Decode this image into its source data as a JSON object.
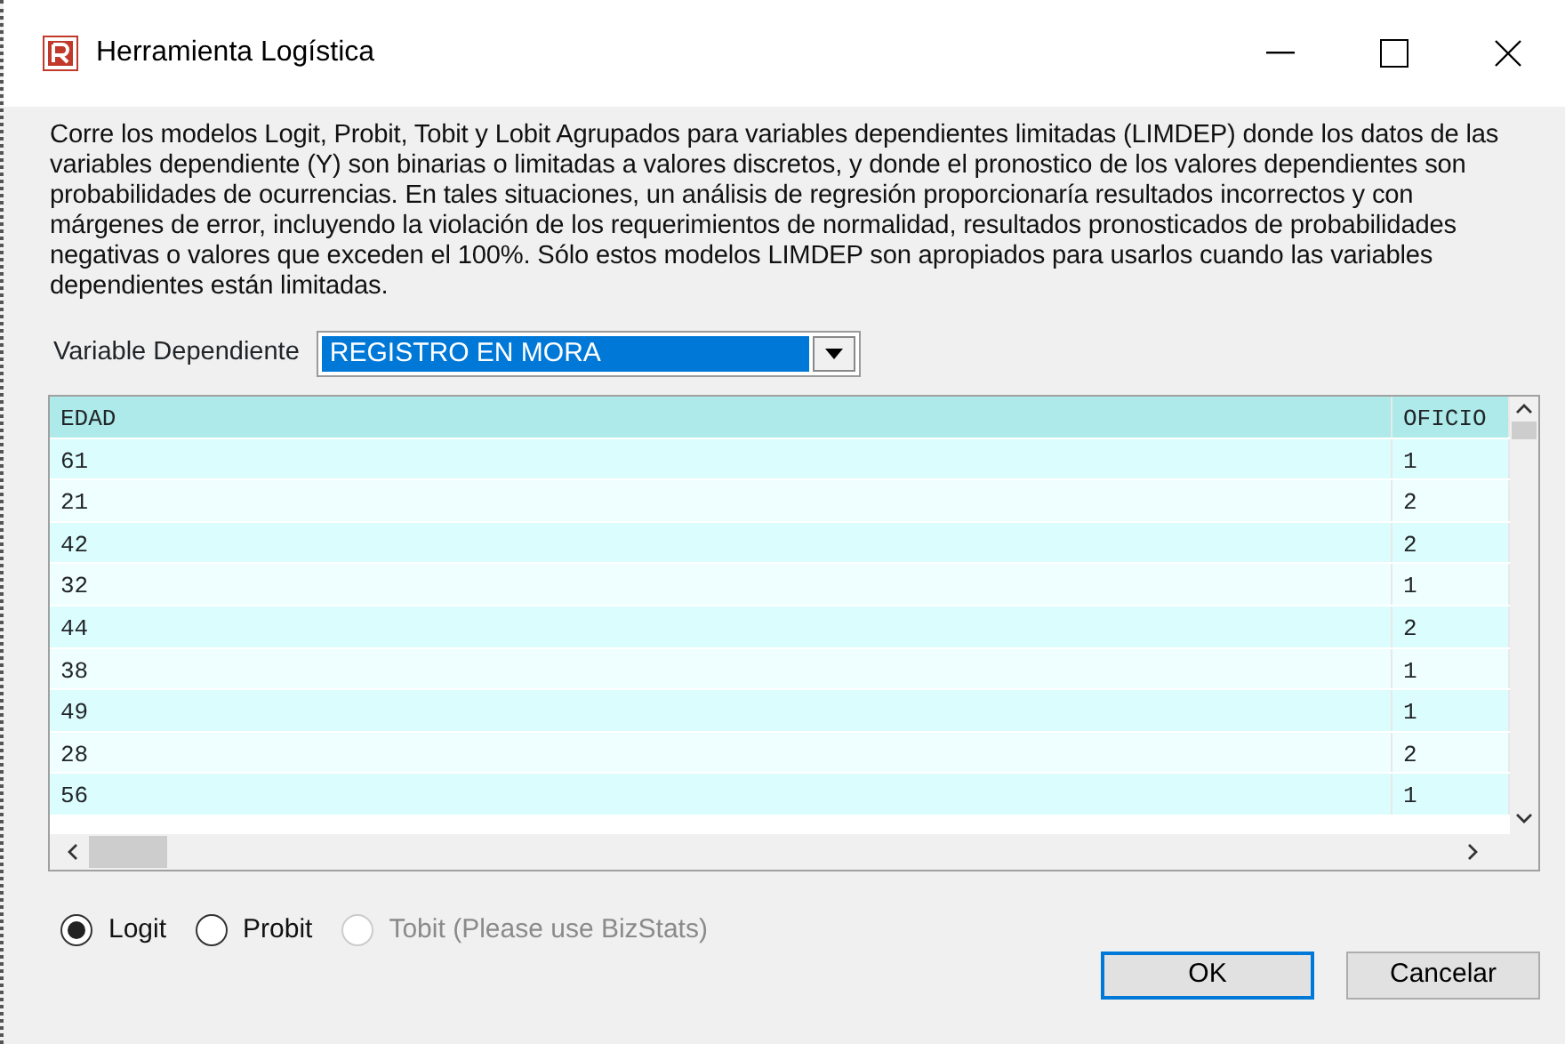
{
  "window": {
    "title": "Herramienta Logística"
  },
  "description": "Corre los modelos Logit, Probit, Tobit y Lobit Agrupados para variables dependientes limitadas (LIMDEP) donde los datos de las variables dependiente (Y) son binarias o limitadas a valores discretos,  y donde el pronostico de los valores dependientes son probabilidades de ocurrencias. En tales situaciones, un análisis de regresión proporcionaría resultados incorrectos y con márgenes de error, incluyendo la violación de los requerimientos de normalidad,  resultados pronosticados de probabilidades negativas o valores que exceden  el 100%. Sólo estos modelos LIMDEP son apropiados para usarlos cuando las variables dependientes están limitadas.",
  "dependent_variable": {
    "label": "Variable Dependiente",
    "value": "REGISTRO EN MORA"
  },
  "table": {
    "columns": [
      "EDAD",
      "OFICIO"
    ],
    "rows": [
      [
        "61",
        "1"
      ],
      [
        "21",
        "2"
      ],
      [
        "42",
        "2"
      ],
      [
        "32",
        "1"
      ],
      [
        "44",
        "2"
      ],
      [
        "38",
        "1"
      ],
      [
        "49",
        "1"
      ],
      [
        "28",
        "2"
      ],
      [
        "56",
        "1"
      ]
    ]
  },
  "models": [
    {
      "label": "Logit",
      "selected": true,
      "disabled": false
    },
    {
      "label": "Probit",
      "selected": false,
      "disabled": false
    },
    {
      "label": "Tobit (Please use BizStats)",
      "selected": false,
      "disabled": true
    }
  ],
  "buttons": [
    {
      "label": "OK",
      "default": true
    },
    {
      "label": "Cancelar",
      "default": false
    }
  ]
}
